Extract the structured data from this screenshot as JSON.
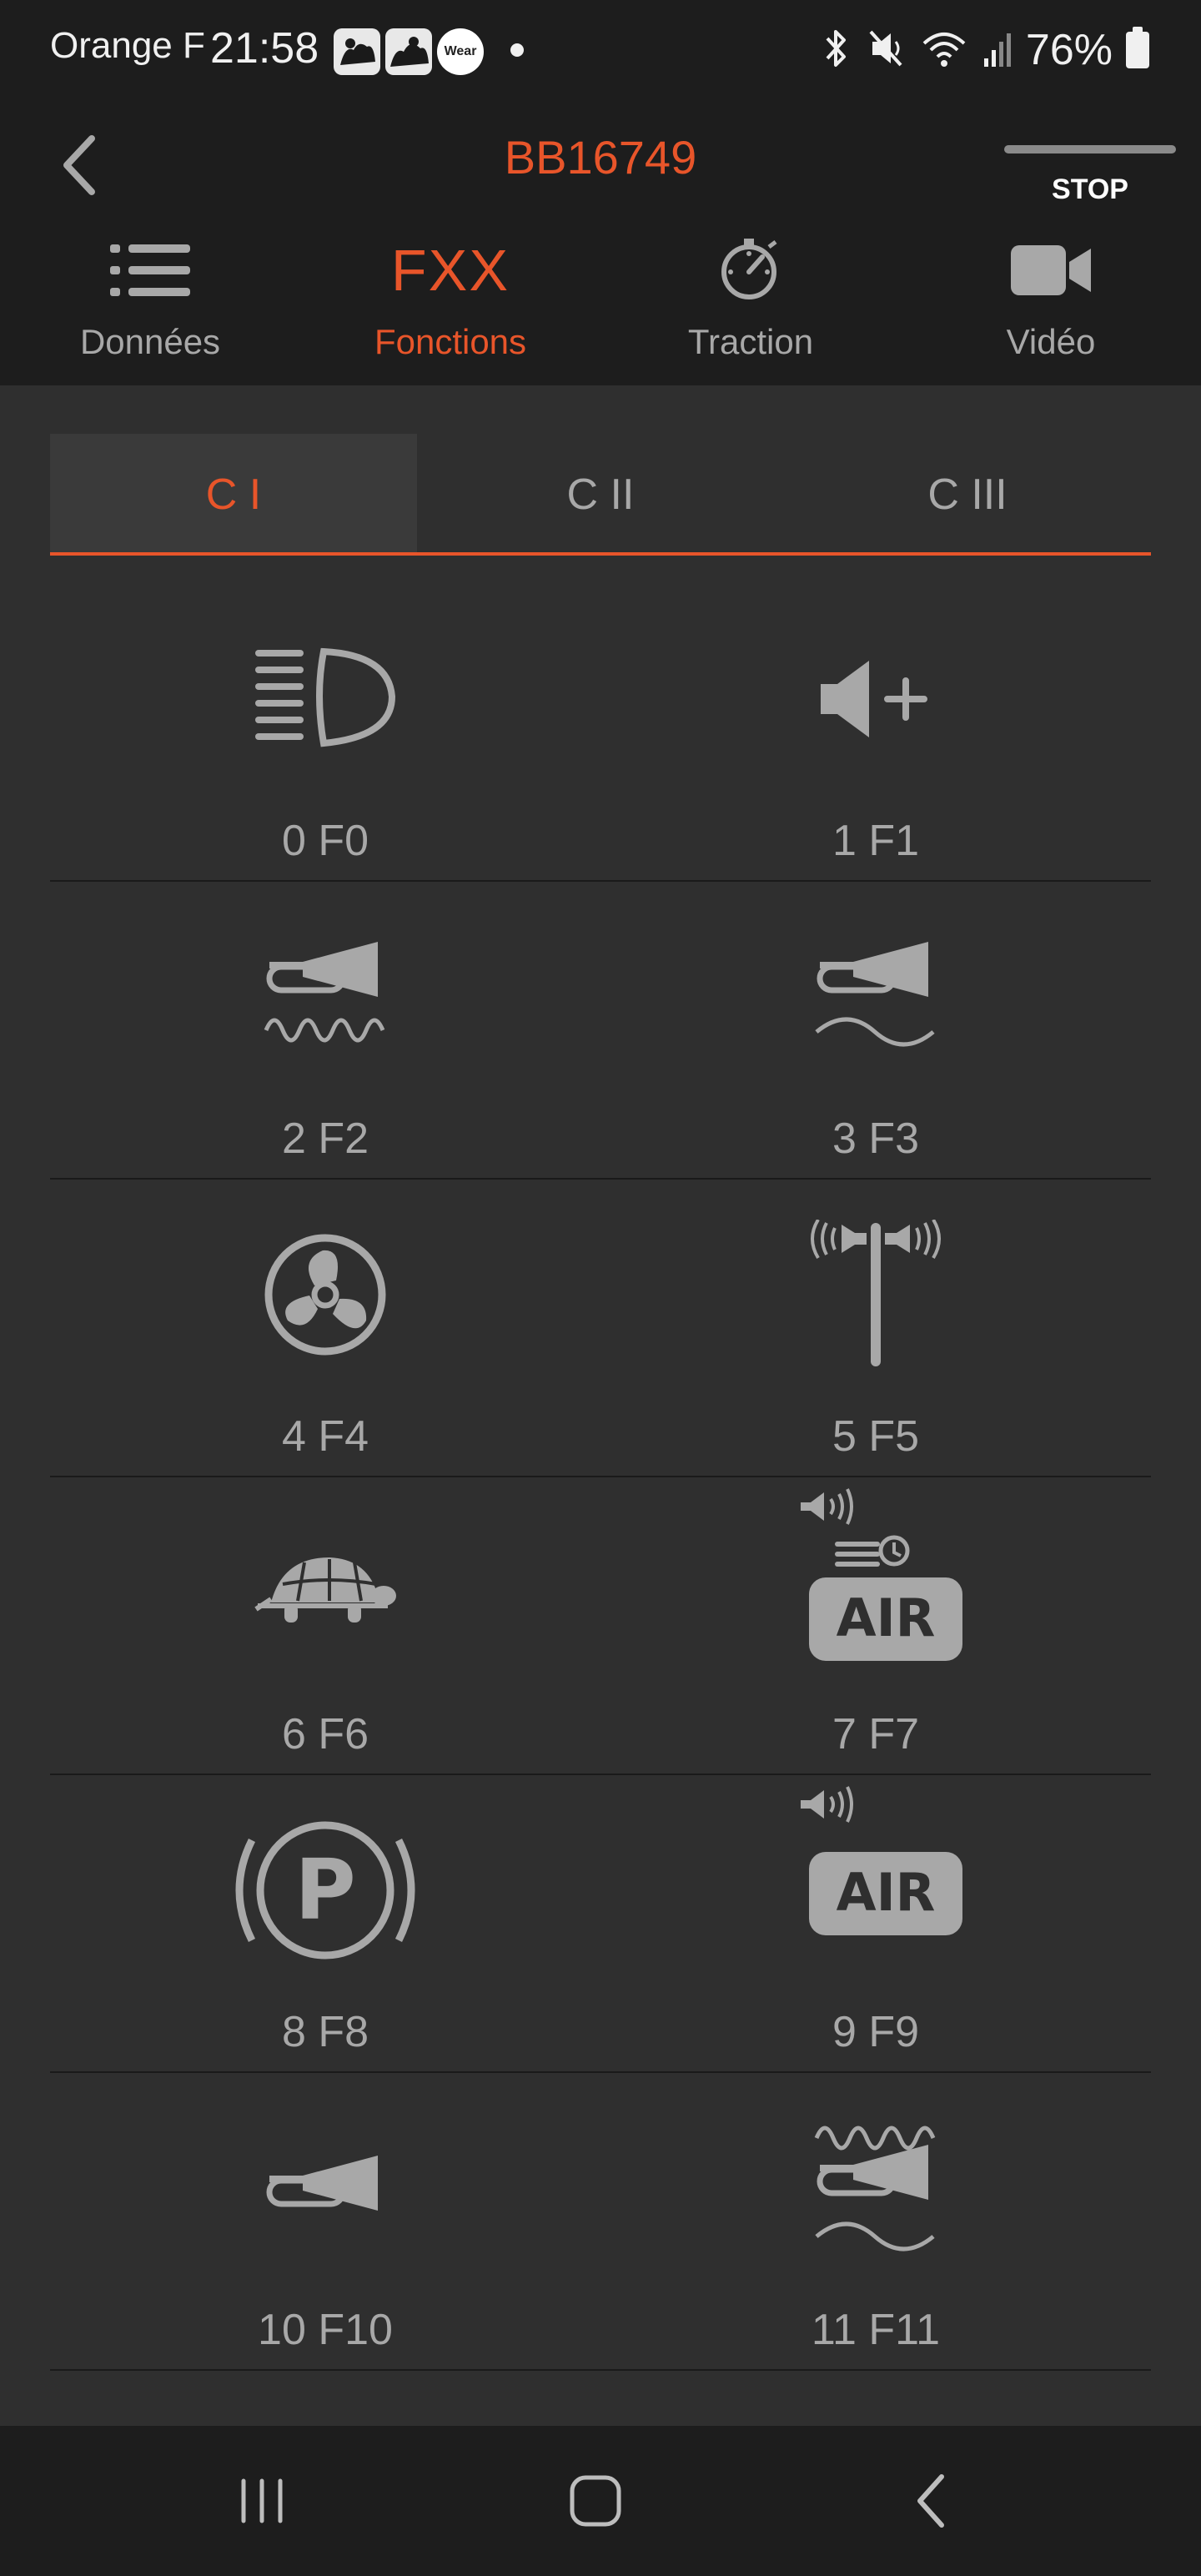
{
  "status_bar": {
    "carrier": "Orange F",
    "time": "21:58",
    "notification_icons": [
      "cat-photo-icon",
      "cat-photo-icon",
      "wear-icon"
    ],
    "wear_label": "Wear",
    "battery_percent": "76%",
    "status_icons": [
      "bluetooth-icon",
      "vibrate-mute-icon",
      "wifi-icon",
      "signal-icon",
      "battery-icon"
    ]
  },
  "header": {
    "title": "BB16749",
    "stop_label": "STOP",
    "accent_color": "#e8552a"
  },
  "tabs": [
    {
      "label": "Données",
      "icon": "list-icon",
      "active": false
    },
    {
      "label": "Fonctions",
      "icon": "FXX",
      "active": true
    },
    {
      "label": "Traction",
      "icon": "speedometer-icon",
      "active": false
    },
    {
      "label": "Vidéo",
      "icon": "video-camera-icon",
      "active": false
    }
  ],
  "subtabs": [
    {
      "label": "C I",
      "active": true
    },
    {
      "label": "C II",
      "active": false
    },
    {
      "label": "C III",
      "active": false
    }
  ],
  "functions": [
    {
      "label": "0 F0",
      "icon": "headlight-icon"
    },
    {
      "label": "1 F1",
      "icon": "volume-up-icon"
    },
    {
      "label": "2 F2",
      "icon": "horn-high-icon"
    },
    {
      "label": "3 F3",
      "icon": "horn-low-icon"
    },
    {
      "label": "4 F4",
      "icon": "fan-icon"
    },
    {
      "label": "5 F5",
      "icon": "pole-speakers-icon"
    },
    {
      "label": "6 F6",
      "icon": "turtle-icon"
    },
    {
      "label": "7 F7",
      "icon": "air-timed-sound-icon",
      "badge": "AIR"
    },
    {
      "label": "8 F8",
      "icon": "parking-brake-icon",
      "badge": "P"
    },
    {
      "label": "9 F9",
      "icon": "air-sound-icon",
      "badge": "AIR"
    },
    {
      "label": "10 F10",
      "icon": "horn-icon"
    },
    {
      "label": "11 F11",
      "icon": "horn-double-icon"
    }
  ],
  "nav": [
    "recent-apps-icon",
    "home-icon",
    "back-icon"
  ]
}
